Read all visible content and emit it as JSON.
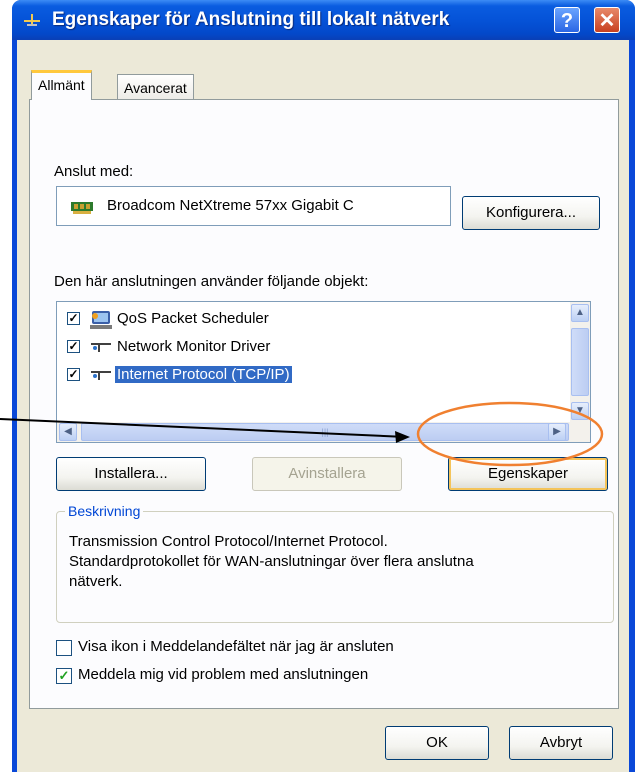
{
  "window": {
    "title": "Egenskaper för Anslutning till lokalt nätverk",
    "help_label": "?",
    "close_label": "✕"
  },
  "tabs": [
    {
      "label": "Allmänt",
      "active": true
    },
    {
      "label": "Avancerat",
      "active": false
    }
  ],
  "general": {
    "connect_using_label": "Anslut med:",
    "device_name": "Broadcom NetXtreme 57xx Gigabit C",
    "configure_label": "Konfigurera...",
    "components_label": "Den här anslutningen använder följande objekt:",
    "items": [
      {
        "label": "QoS Packet Scheduler",
        "checked": true,
        "selected": false,
        "icon": "qos-scheduler-icon"
      },
      {
        "label": "Network Monitor Driver",
        "checked": true,
        "selected": false,
        "icon": "network-protocol-icon"
      },
      {
        "label": "Internet Protocol (TCP/IP)",
        "checked": true,
        "selected": true,
        "icon": "network-protocol-icon"
      }
    ],
    "install_label": "Installera...",
    "uninstall_label": "Avinstallera",
    "properties_label": "Egenskaper",
    "description_title": "Beskrivning",
    "description_lines": [
      "Transmission Control Protocol/Internet Protocol.",
      "Standardprotokollet för WAN-anslutningar över flera anslutna",
      "nätverk."
    ],
    "show_icon_label": "Visa ikon i Meddelandefältet när jag är ansluten",
    "show_icon_checked": false,
    "notify_label": "Meddela mig vid problem med anslutningen",
    "notify_checked": true
  },
  "footer": {
    "ok_label": "OK",
    "cancel_label": "Avbryt"
  },
  "colors": {
    "titlebar": "#0553d8",
    "selection": "#316ac5",
    "annotation_highlight": "#f08030"
  }
}
